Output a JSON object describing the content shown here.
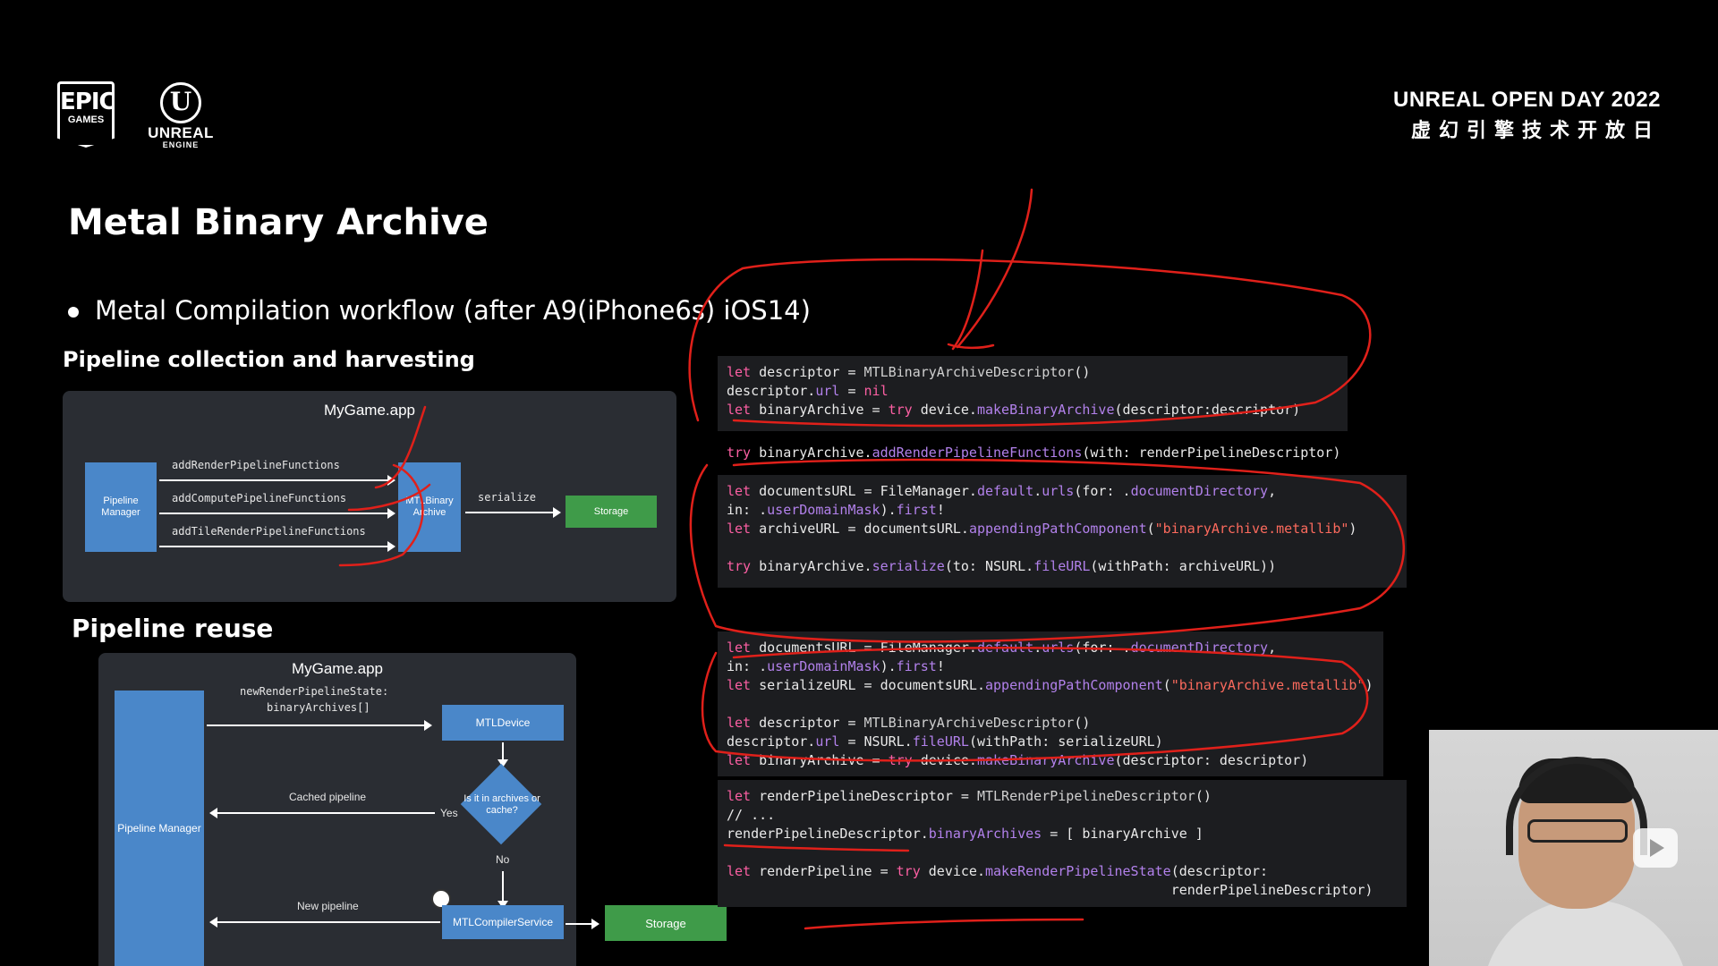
{
  "logos": {
    "epic_line1": "EPIC",
    "epic_line2": "GAMES",
    "ue_mark": "U",
    "ue_word": "UNREAL",
    "ue_sub": "ENGINE"
  },
  "brand": {
    "en": "UNREAL OPEN DAY 2022",
    "cn": "虚幻引擎技术开放日"
  },
  "slide": {
    "title": "Metal Binary Archive",
    "bullet": "Metal Compilation workflow (after A9(iPhone6s) iOS14)",
    "section1": "Pipeline collection and harvesting",
    "section2": "Pipeline reuse"
  },
  "diagram1": {
    "app": "MyGame.app",
    "pipeline_manager": "Pipeline Manager",
    "archive": "MTLBinary Archive",
    "storage": "Storage",
    "arrow1": "addRenderPipelineFunctions",
    "arrow2": "addComputePipelineFunctions",
    "arrow3": "addTileRenderPipelineFunctions",
    "serialize": "serialize"
  },
  "diagram2": {
    "app": "MyGame.app",
    "pipeline_manager": "Pipeline Manager",
    "new_state": "newRenderPipelineState:",
    "binary_archives": "binaryArchives[]",
    "device": "MTLDevice",
    "decision": "Is it in archives or cache?",
    "cached": "Cached pipeline",
    "yes": "Yes",
    "no": "No",
    "new_pipeline": "New pipeline",
    "compiler": "MTLCompilerService",
    "storage": "Storage"
  },
  "code": {
    "block1": [
      [
        [
          "kw",
          "let"
        ],
        [
          "t",
          " descriptor = "
        ],
        [
          "ty",
          "MTLBinaryArchiveDescriptor"
        ],
        [
          "t",
          "()"
        ]
      ],
      [
        [
          "t",
          "descriptor."
        ],
        [
          "fn",
          "url"
        ],
        [
          "t",
          " = "
        ],
        [
          "kw",
          "nil"
        ]
      ],
      [
        [
          "kw",
          "let"
        ],
        [
          "t",
          " binaryArchive = "
        ],
        [
          "kw",
          "try"
        ],
        [
          "t",
          " device."
        ],
        [
          "fn",
          "makeBinaryArchive"
        ],
        [
          "t",
          "(descriptor:descriptor)"
        ]
      ]
    ],
    "line_add": [
      [
        "kw",
        "try"
      ],
      [
        "t",
        " binaryArchive."
      ],
      [
        "fn",
        "addRenderPipelineFunctions"
      ],
      [
        "t",
        "(with: renderPipelineDescriptor)"
      ]
    ],
    "block2": [
      [
        [
          "kw",
          "let"
        ],
        [
          "t",
          " documentsURL = FileManager."
        ],
        [
          "fn",
          "default"
        ],
        [
          "t",
          "."
        ],
        [
          "fn",
          "urls"
        ],
        [
          "t",
          "(for: ."
        ],
        [
          "fn",
          "documentDirectory"
        ],
        [
          "t",
          ","
        ]
      ],
      [
        [
          "t",
          "in: ."
        ],
        [
          "fn",
          "userDomainMask"
        ],
        [
          "t",
          ")."
        ],
        [
          "fn",
          "first"
        ],
        [
          "t",
          "!"
        ]
      ],
      [
        [
          "kw",
          "let"
        ],
        [
          "t",
          " archiveURL = documentsURL."
        ],
        [
          "fn",
          "appendingPathComponent"
        ],
        [
          "t",
          "("
        ],
        [
          "st",
          "\"binaryArchive.metallib\""
        ],
        [
          "t",
          ")"
        ]
      ],
      [],
      [
        [
          "kw",
          "try"
        ],
        [
          "t",
          " binaryArchive."
        ],
        [
          "fn",
          "serialize"
        ],
        [
          "t",
          "(to: NSURL."
        ],
        [
          "fn",
          "fileURL"
        ],
        [
          "t",
          "(withPath: archiveURL))"
        ]
      ]
    ],
    "block3": [
      [
        [
          "kw",
          "let"
        ],
        [
          "t",
          " documentsURL = FileManager."
        ],
        [
          "fn",
          "default"
        ],
        [
          "t",
          "."
        ],
        [
          "fn",
          "urls"
        ],
        [
          "t",
          "(for: ."
        ],
        [
          "fn",
          "documentDirectory"
        ],
        [
          "t",
          ","
        ]
      ],
      [
        [
          "t",
          "in: ."
        ],
        [
          "fn",
          "userDomainMask"
        ],
        [
          "t",
          ")."
        ],
        [
          "fn",
          "first"
        ],
        [
          "t",
          "!"
        ]
      ],
      [
        [
          "kw",
          "let"
        ],
        [
          "t",
          " serializeURL = documentsURL."
        ],
        [
          "fn",
          "appendingPathComponent"
        ],
        [
          "t",
          "("
        ],
        [
          "st",
          "\"binaryArchive.metallib\""
        ],
        [
          "t",
          ")"
        ]
      ],
      [],
      [
        [
          "kw",
          "let"
        ],
        [
          "t",
          " descriptor = "
        ],
        [
          "ty",
          "MTLBinaryArchiveDescriptor"
        ],
        [
          "t",
          "()"
        ]
      ],
      [
        [
          "t",
          "descriptor."
        ],
        [
          "fn",
          "url"
        ],
        [
          "t",
          " = NSURL."
        ],
        [
          "fn",
          "fileURL"
        ],
        [
          "t",
          "(withPath: serializeURL)"
        ]
      ],
      [
        [
          "kw",
          "let"
        ],
        [
          "t",
          " binaryArchive = "
        ],
        [
          "kw",
          "try"
        ],
        [
          "t",
          " device."
        ],
        [
          "fn",
          "makeBinaryArchive"
        ],
        [
          "t",
          "(descriptor: descriptor)"
        ]
      ]
    ],
    "block4": [
      [
        [
          "kw",
          "let"
        ],
        [
          "t",
          " renderPipelineDescriptor = "
        ],
        [
          "ty",
          "MTLRenderPipelineDescriptor"
        ],
        [
          "t",
          "()"
        ]
      ],
      [
        [
          "t",
          "// ..."
        ]
      ],
      [
        [
          "t",
          "renderPipelineDescriptor."
        ],
        [
          "fn",
          "binaryArchives"
        ],
        [
          "t",
          " = [ binaryArchive ]"
        ]
      ],
      [],
      [
        [
          "kw",
          "let"
        ],
        [
          "t",
          " renderPipeline = "
        ],
        [
          "kw",
          "try"
        ],
        [
          "t",
          " device."
        ],
        [
          "fn",
          "makeRenderPipelineState"
        ],
        [
          "t",
          "(descriptor:"
        ]
      ],
      [
        [
          "t",
          "                                                       renderPipelineDescriptor)"
        ]
      ]
    ]
  },
  "colors": {
    "background": "#000000",
    "panel": "#2a2d33",
    "box_blue": "#4a87c9",
    "box_green": "#3f9b49",
    "keyword": "#fc5fa3",
    "function": "#b281eb",
    "string": "#fc6a5d",
    "annotation": "#e0201a"
  }
}
